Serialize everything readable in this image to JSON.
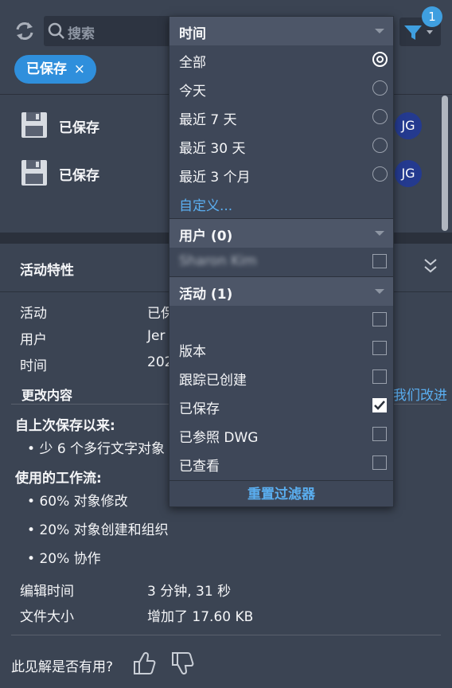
{
  "header": {
    "search_placeholder": "搜索",
    "filter_badge": "1",
    "chip_label": "已保存",
    "chip_close": "×"
  },
  "list": {
    "items": [
      {
        "label": "已保存",
        "avatar": "JG"
      },
      {
        "label": "已保存",
        "avatar": "JG"
      }
    ]
  },
  "props": {
    "title": "活动特性",
    "rows": [
      {
        "key": "活动",
        "value": "已保"
      },
      {
        "key": "用户",
        "value": "Jer"
      },
      {
        "key": "时间",
        "value": "202"
      }
    ],
    "changes_heading": "更改内容",
    "link_tail": "我们改进",
    "since_save_title": "自上次保存以来:",
    "since_save_items": [
      "少 6 个多行文字对象"
    ],
    "workflows_title": "使用的工作流:",
    "workflows": [
      "60% 对象修改",
      "20% 对象创建和组织",
      "20% 协作"
    ],
    "edit_time_label": "编辑时间",
    "edit_time_value": "3 分钟, 31 秒",
    "file_size_label": "文件大小",
    "file_size_value": "增加了 17.60 KB",
    "feedback_question": "此见解是否有用?"
  },
  "dropdown": {
    "time_title": "时间",
    "time_options": [
      "全部",
      "今天",
      "最近 7 天",
      "最近 30 天",
      "最近 3 个月"
    ],
    "time_selected_index": 0,
    "custom_link": "自定义...",
    "user_title": "用户 (0)",
    "user_options": [
      "Sharon Kim"
    ],
    "activity_title": "活动 (1)",
    "activity_options": [
      "",
      "版本",
      "跟踪已创建",
      "已保存",
      "已参照 DWG",
      "已查看"
    ],
    "activity_checked": [
      false,
      false,
      false,
      true,
      false,
      false
    ],
    "reset_label": "重置过滤器"
  },
  "colors": {
    "accent": "#2f8fdc",
    "link": "#5aaef0",
    "avatar": "#243a8f",
    "background": "#3b4453"
  }
}
